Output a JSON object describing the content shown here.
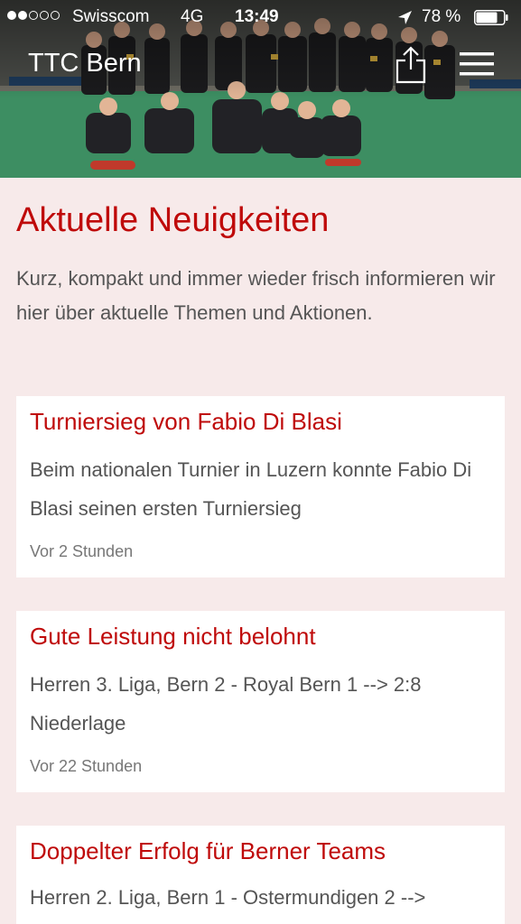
{
  "status_bar": {
    "carrier": "Swisscom",
    "network": "4G",
    "time": "13:49",
    "battery": "78 %",
    "battery_level": 0.78
  },
  "header": {
    "title": "TTC Bern",
    "share_icon": "share-icon",
    "menu_icon": "hamburger-menu-icon"
  },
  "main": {
    "title": "Aktuelle Neuigkeiten",
    "intro": "Kurz, kompakt und immer wieder frisch informieren wir hier über aktuelle Themen und Aktionen.",
    "articles": [
      {
        "title": "Turniersieg von Fabio Di Blasi",
        "text": "Beim nationalen Turnier in Luzern konnte Fabio Di Blasi seinen ersten Turniersieg",
        "time": "Vor 2 Stunden"
      },
      {
        "title": "Gute Leistung nicht belohnt",
        "text": "Herren 3. Liga, Bern 2 - Royal Bern 1 --> 2:8 Niederlage",
        "time": "Vor 22 Stunden"
      },
      {
        "title": "Doppelter Erfolg für Berner Teams",
        "text": "Herren 2. Liga, Bern 1 - Ostermundigen 2 -->",
        "time": ""
      }
    ]
  },
  "colors": {
    "accent": "#bf0a0a",
    "background": "#f7eaea",
    "card": "#ffffff",
    "text": "#555555"
  }
}
